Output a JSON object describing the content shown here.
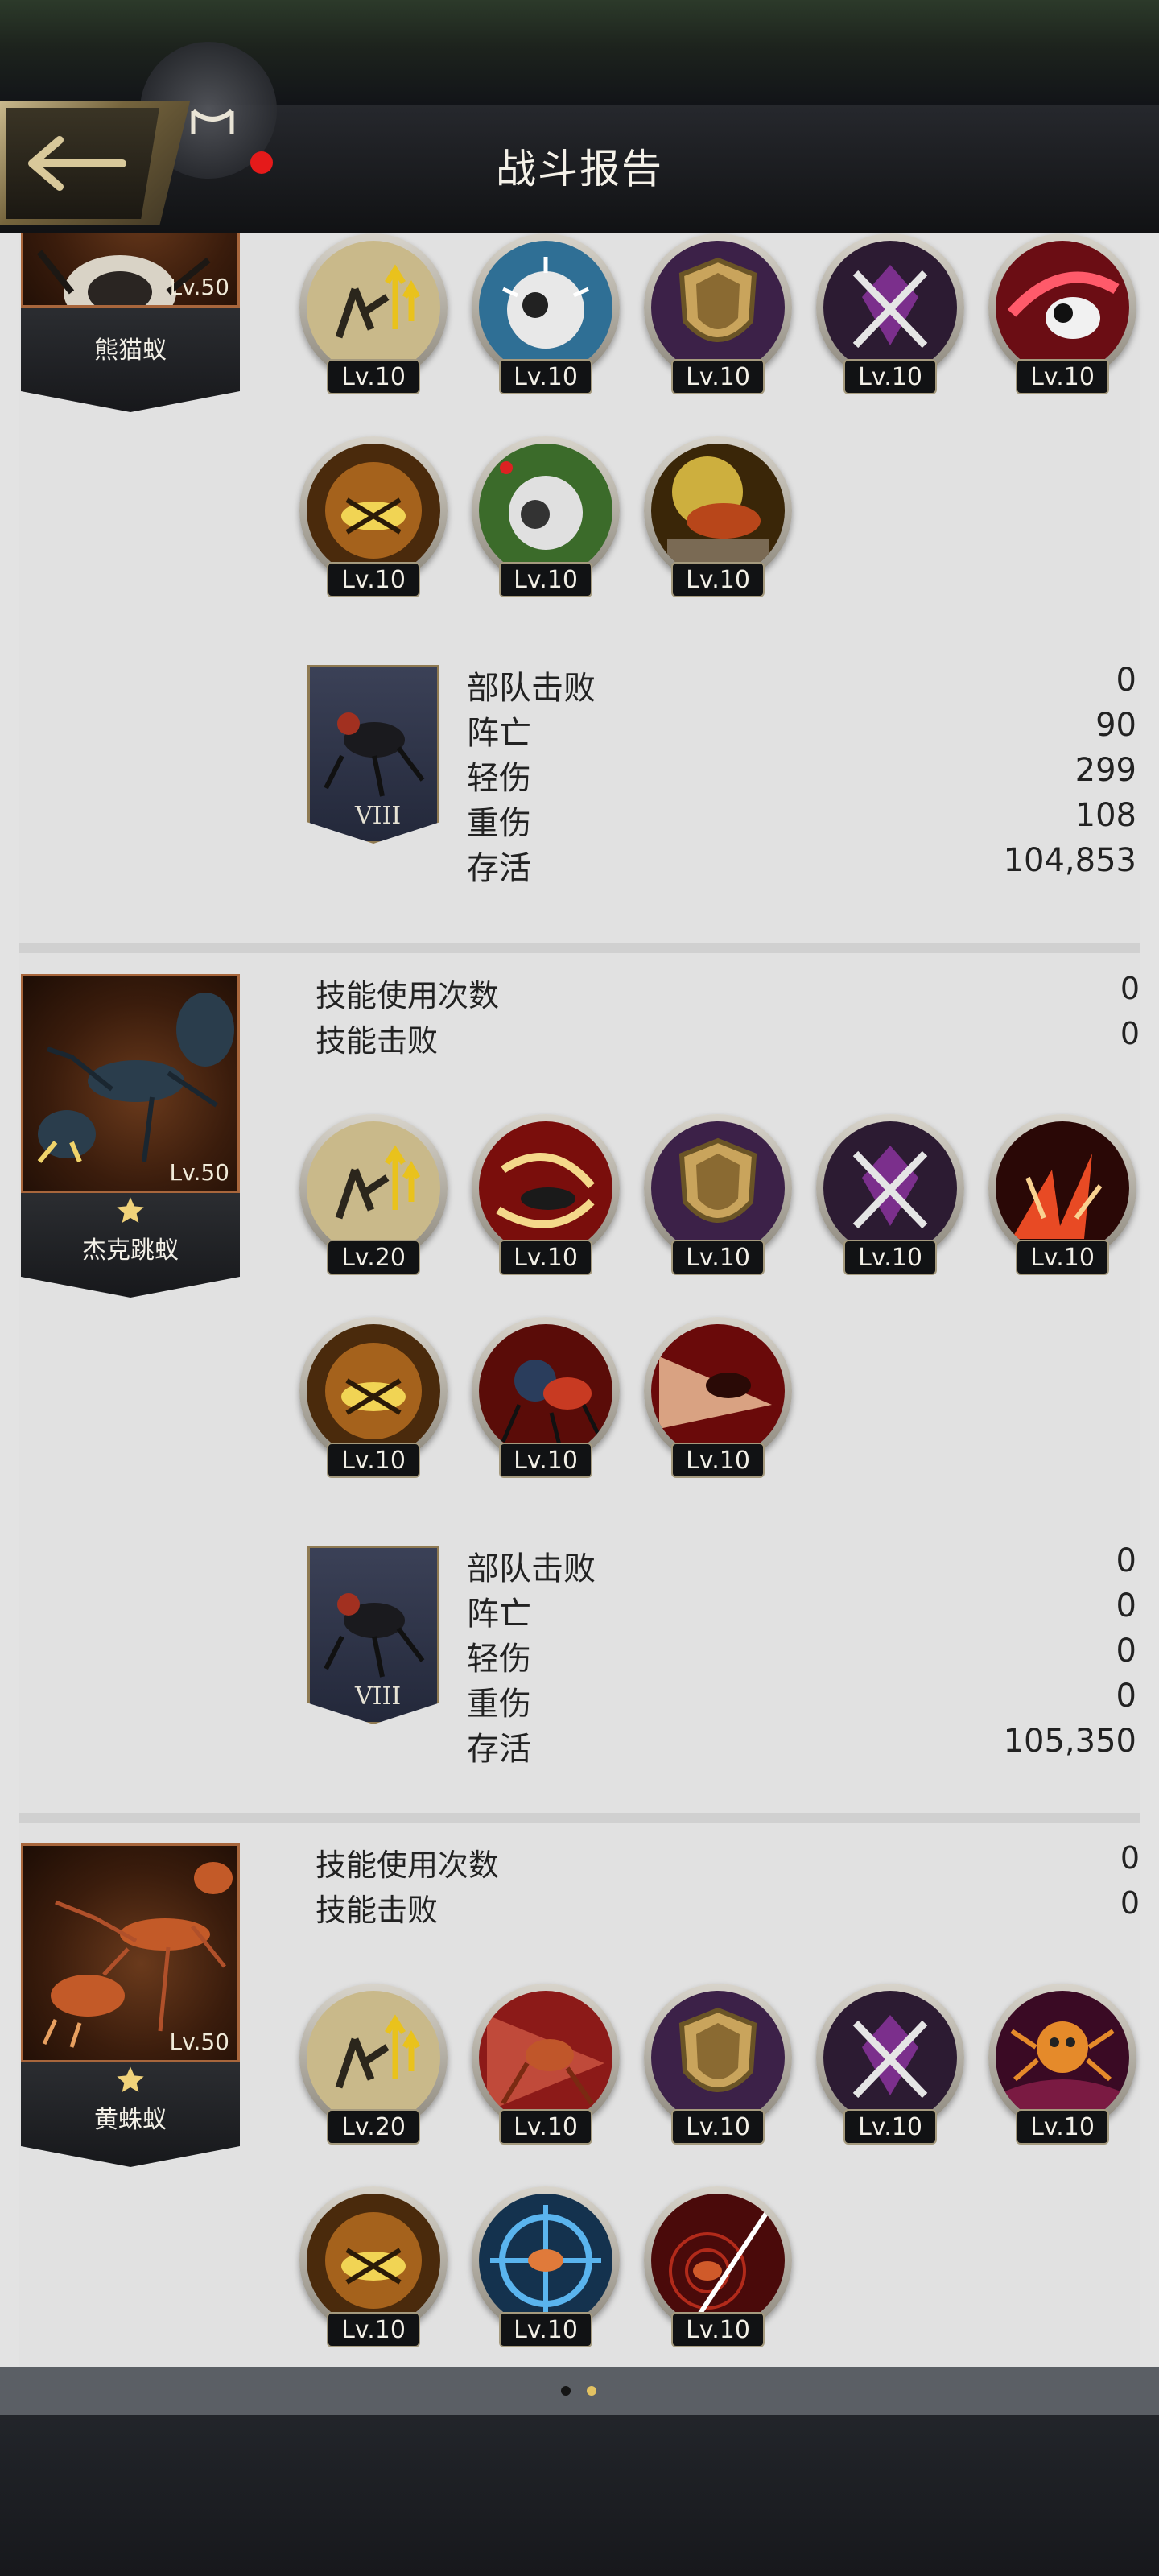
{
  "header": {
    "title": "战斗报告",
    "back_icon": "back-arrow-icon",
    "mail_icon": "mail-icon",
    "notification_color": "#e51a1a"
  },
  "labels": {
    "skill_uses": "技能使用次数",
    "skill_defeats": "技能击败",
    "stat_defeated": "部队击败",
    "stat_dead": "阵亡",
    "stat_light": "轻伤",
    "stat_heavy": "重伤",
    "stat_survive": "存活"
  },
  "units": [
    {
      "name": "熊猫蚁",
      "level": "Lv.50",
      "skills": [
        "Lv.10",
        "Lv.10",
        "Lv.10",
        "Lv.10",
        "Lv.10",
        "Lv.10",
        "Lv.10",
        "Lv.10"
      ],
      "troop_tier": "VIII",
      "stats": {
        "defeated": "0",
        "dead": "90",
        "light": "299",
        "heavy": "108",
        "survive": "104,853"
      }
    },
    {
      "name": "杰克跳蚁",
      "level": "Lv.50",
      "skill_uses": "0",
      "skill_defeats": "0",
      "skills": [
        "Lv.20",
        "Lv.10",
        "Lv.10",
        "Lv.10",
        "Lv.10",
        "Lv.10",
        "Lv.10",
        "Lv.10"
      ],
      "troop_tier": "VIII",
      "stats": {
        "defeated": "0",
        "dead": "0",
        "light": "0",
        "heavy": "0",
        "survive": "105,350"
      }
    },
    {
      "name": "黄蛛蚁",
      "level": "Lv.50",
      "skill_uses": "0",
      "skill_defeats": "0",
      "skills": [
        "Lv.20",
        "Lv.10",
        "Lv.10",
        "Lv.10",
        "Lv.10",
        "Lv.10",
        "Lv.10",
        "Lv.10"
      ]
    }
  ],
  "pager": {
    "page_count": 2,
    "active_color": "#e3c262",
    "inactive_color": "#151515"
  },
  "colors": {
    "accent_gold": "#a8663c",
    "panel": "#e1e1e1"
  }
}
